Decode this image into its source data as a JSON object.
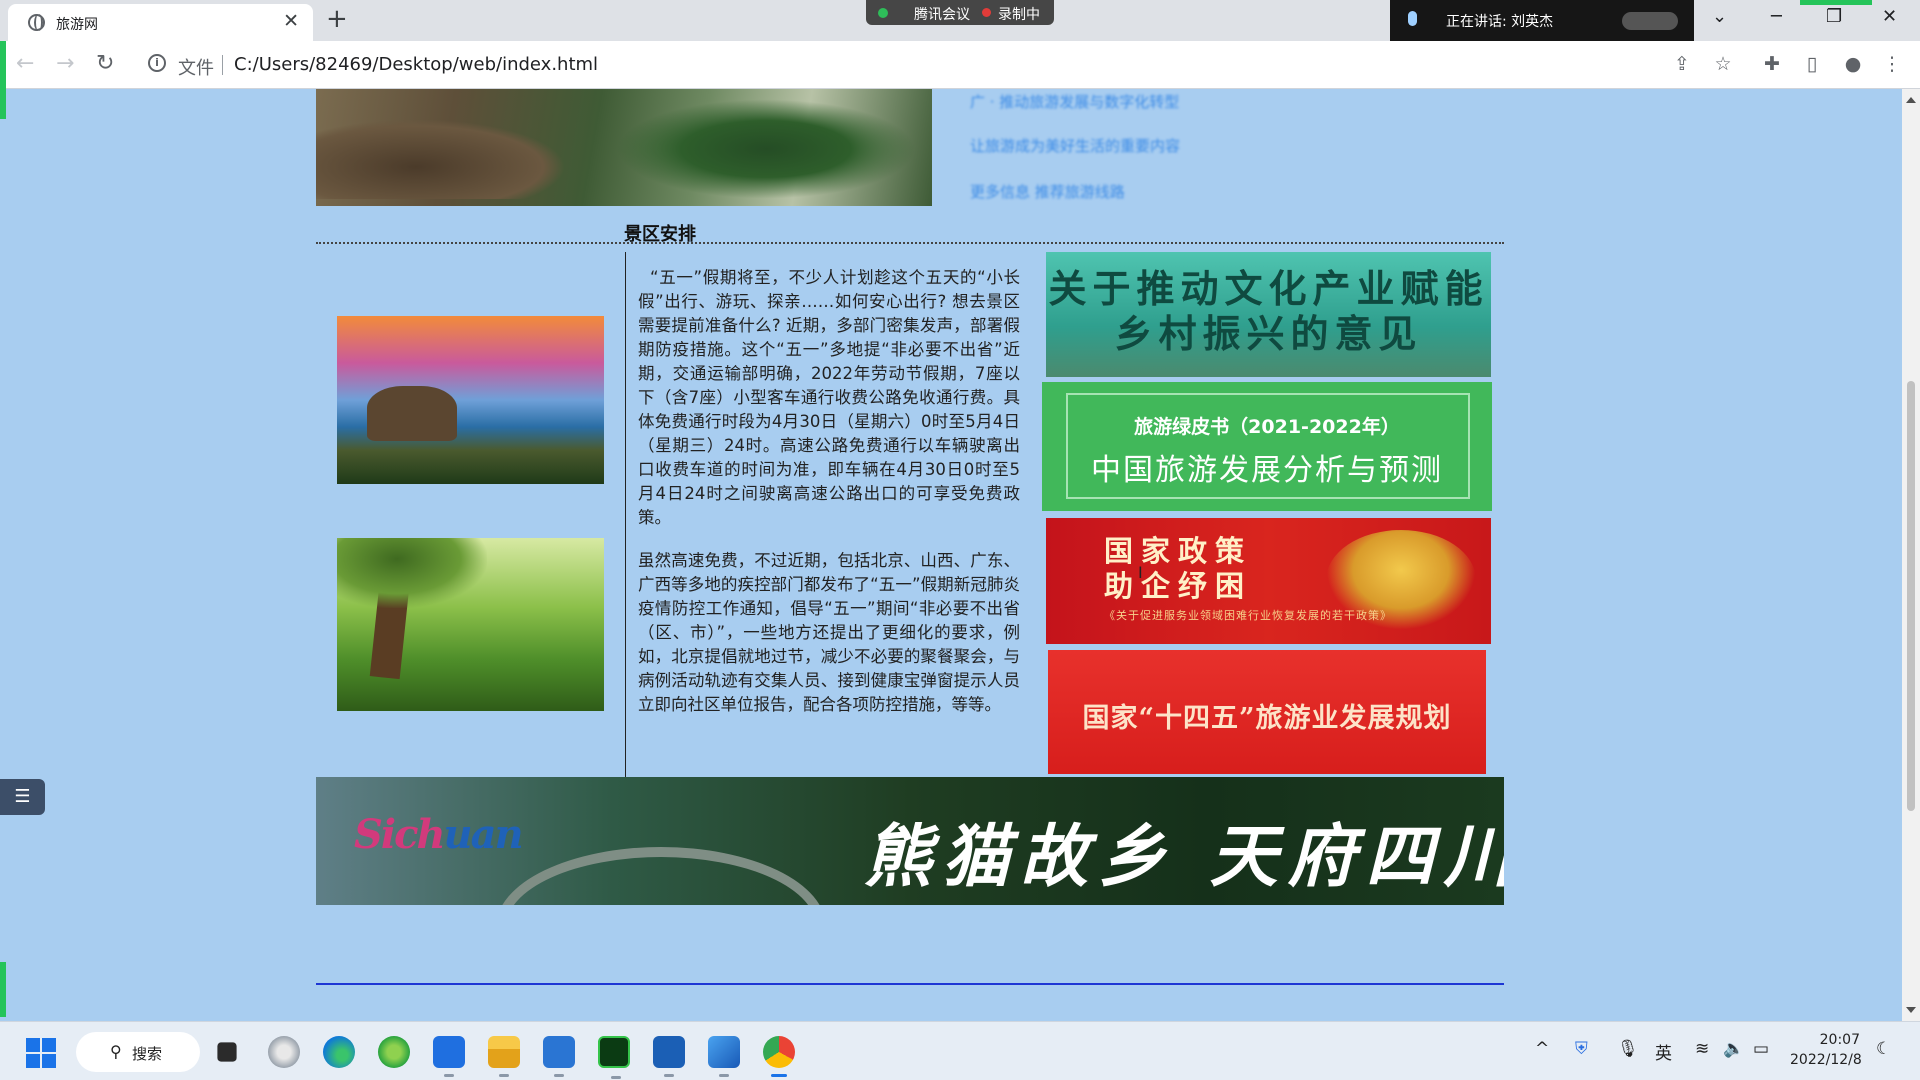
{
  "browser": {
    "tab_title": "旅游网",
    "new_tab": "+",
    "tab_close": "✕",
    "address_scheme": "文件",
    "address_url": "C:/Users/82469/Desktop/web/index.html",
    "meeting_app": "腾讯会议",
    "recording": "录制中",
    "speaking_label": "正在讲话: 刘英杰"
  },
  "page": {
    "top_links": [
      "广 · 推动旅游发展与数字化转型",
      "让旅游成为美好生活的重要内容",
      "更多信息 推荐旅游线路"
    ],
    "section_title": "景区安排",
    "article_p1": "“五一”假期将至，不少人计划趁这个五天的“小长假”出行、游玩、探亲……如何安心出行? 想去景区需要提前准备什么? 近期，多部门密集发声，部署假期防疫措施。这个“五一”多地提“非必要不出省”近期，交通运输部明确，2022年劳动节假期，7座以下（含7座）小型客车通行收费公路免收通行费。具体免费通行时段为4月30日（星期六）0时至5月4日（星期三）24时。高速公路免费通行以车辆驶离出口收费车道的时间为准，即车辆在4月30日0时至5月4日24时之间驶离高速公路出口的可享受免费政策。",
    "article_p2": "虽然高速免费，不过近期，包括北京、山西、广东、广西等多地的疾控部门都发布了“五一”假期新冠肺炎疫情防控工作通知，倡导“五一”期间“非必要不出省（区、市）”，一些地方还提出了更细化的要求，例如，北京提倡就地过节，减少不必要的聚餐聚会，与病例活动轨迹有交集人员、接到健康宝弹窗提示人员立即向社区单位报告，配合各项防控措施，等等。",
    "banner_culture": "关于推动文化产业赋能乡村振兴的意见",
    "banner_green_1": "旅游绿皮书（2021-2022年）",
    "banner_green_2": "中国旅游发展分析与预测",
    "banner_policy_1": "国家政策",
    "banner_policy_2": "助企纾困",
    "banner_policy_sub": "《关于促进服务业领域困难行业恢复发展的若干政策》",
    "banner_plan": "国家“十四五”旅游业发展规划",
    "sichuan_logo_a": "Sich",
    "sichuan_logo_b": "uan",
    "sichuan_calligraphy": "熊猫故乡  天府四川",
    "float_menu": "☰"
  },
  "taskbar": {
    "search_label": "搜索",
    "ime": "英",
    "time": "20:07",
    "date": "2022/12/8"
  },
  "colors": {
    "page_bg": "#a8cdf0",
    "link": "#3a8ae6",
    "rule_blue": "#1d36d4",
    "green_banner": "#41b85a",
    "red_banner": "#d71e1c"
  }
}
